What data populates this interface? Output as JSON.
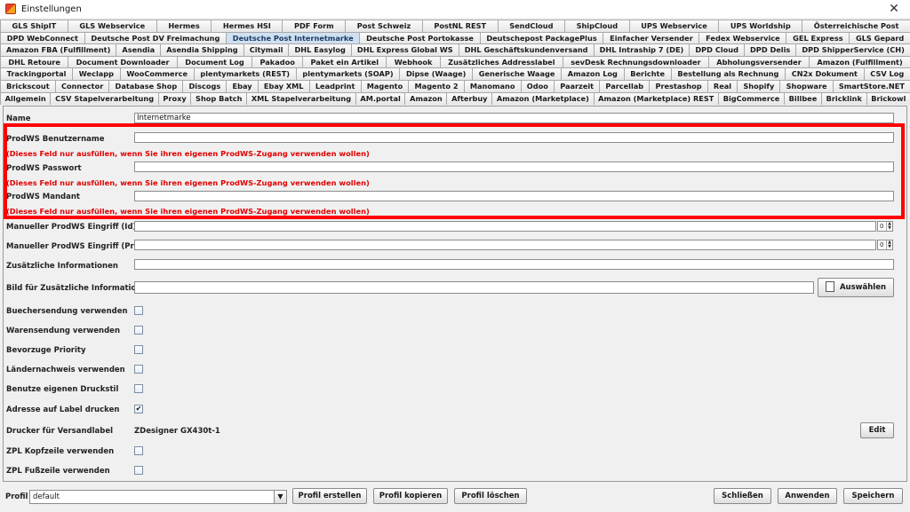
{
  "window": {
    "title": "Einstellungen",
    "close_glyph": "✕"
  },
  "tabs": {
    "rows": [
      [
        "GLS ShipIT",
        "GLS Webservice",
        "Hermes",
        "Hermes HSI",
        "PDF Form",
        "Post Schweiz",
        "PostNL REST",
        "SendCloud",
        "ShipCloud",
        "UPS Webservice",
        "UPS Worldship",
        "Österreichische Post"
      ],
      [
        "DPD WebConnect",
        "Deutsche Post DV Freimachung",
        "Deutsche Post Internetmarke",
        "Deutsche Post Portokasse",
        "Deutschepost PackagePlus",
        "Einfacher Versender",
        "Fedex Webservice",
        "GEL Express",
        "GLS Gepard"
      ],
      [
        "Amazon FBA (Fulfillment)",
        "Asendia",
        "Asendia Shipping",
        "Citymail",
        "DHL Easylog",
        "DHL Express Global WS",
        "DHL Geschäftskundenversand",
        "DHL Intraship 7 (DE)",
        "DPD Cloud",
        "DPD Delis",
        "DPD ShipperService (CH)"
      ],
      [
        "DHL Retoure",
        "Document Downloader",
        "Document Log",
        "Pakadoo",
        "Paket ein Artikel",
        "Webhook",
        "Zusätzliches Addresslabel",
        "sevDesk Rechnungsdownloader",
        "Abholungsversender",
        "Amazon (Fulfillment)"
      ],
      [
        "Trackingportal",
        "Weclapp",
        "WooCommerce",
        "plentymarkets (REST)",
        "plentymarkets (SOAP)",
        "Dipse (Waage)",
        "Generische Waage",
        "Amazon Log",
        "Berichte",
        "Bestellung als Rechnung",
        "CN2x Dokument",
        "CSV Log"
      ],
      [
        "Brickscout",
        "Connector",
        "Database Shop",
        "Discogs",
        "Ebay",
        "Ebay XML",
        "Leadprint",
        "Magento",
        "Magento 2",
        "Manomano",
        "Odoo",
        "Paarzeit",
        "Parcellab",
        "Prestashop",
        "Real",
        "Shopify",
        "Shopware",
        "SmartStore.NET"
      ],
      [
        "Allgemein",
        "CSV Stapelverarbeitung",
        "Proxy",
        "Shop Batch",
        "XML Stapelverarbeitung",
        "AM.portal",
        "Amazon",
        "Afterbuy",
        "Amazon (Marketplace)",
        "Amazon (Marketplace) REST",
        "BigCommerce",
        "Billbee",
        "Bricklink",
        "Brickowl"
      ]
    ],
    "active": "Deutsche Post Internetmarke"
  },
  "form": {
    "name_label": "Name",
    "name_value": "Internetmarke",
    "user_label": "ProdWS Benutzername",
    "user_value": "",
    "hint_text": "(Dieses Feld nur ausfüllen, wenn Sie ihren eigenen ProdWS-Zugang verwenden wollen)",
    "password_label": "ProdWS Passwort",
    "password_value": "",
    "mandant_label": "ProdWS Mandant",
    "mandant_value": "",
    "manual_id_label": "Manueller ProdWS Eingriff (Id) *",
    "manual_id_value": "0",
    "manual_price_label": "Manueller ProdWS Eingriff (Preis)",
    "manual_price_value": "0",
    "additional_info_label": "Zusätzliche Informationen",
    "additional_info_value": "",
    "image_label": "Bild für Zusätzliche Informationen",
    "image_value": "",
    "choose_button": "Auswählen",
    "buecher_label": "Buechersendung verwenden",
    "waren_label": "Warensendung verwenden",
    "priority_label": "Bevorzuge Priority",
    "laender_label": "Ländernachweis verwenden",
    "druckstil_label": "Benutze eigenen Druckstil",
    "adresse_label": "Adresse auf Label drucken",
    "checked_glyph": "✔",
    "drucker_label": "Drucker für Versandlabel",
    "drucker_value": "ZDesigner GX430t-1",
    "edit_button": "Edit",
    "zpl_kopf_label": "ZPL Kopfzeile verwenden",
    "zpl_fuss_label": "ZPL Fußzeile verwenden"
  },
  "bottom": {
    "profile_label": "Profil",
    "profile_value": "default",
    "create_button": "Profil erstellen",
    "copy_button": "Profil kopieren",
    "delete_button": "Profil löschen",
    "close_button": "Schließen",
    "apply_button": "Anwenden",
    "save_button": "Speichern"
  },
  "colors": {
    "highlight_box": "#ff0000",
    "hint_text": "#e00000",
    "active_tab": "#cfe0f0"
  }
}
